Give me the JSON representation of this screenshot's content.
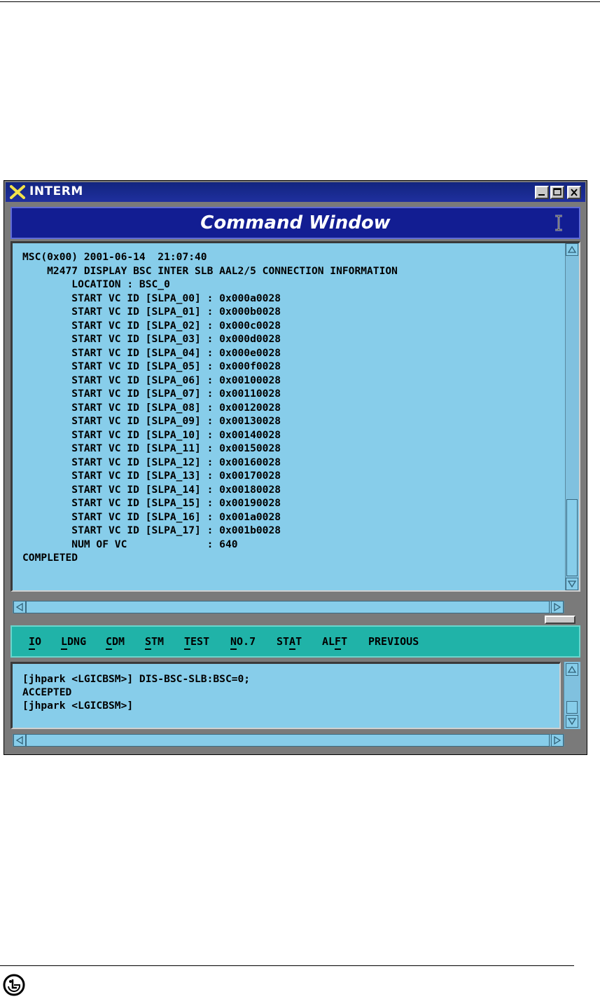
{
  "window": {
    "title": "INTERM",
    "command_title": "Command Window"
  },
  "output": {
    "lines": [
      "MSC(0x00) 2001-06-14  21:07:40",
      "    M2477 DISPLAY BSC INTER SLB AAL2/5 CONNECTION INFORMATION",
      "        LOCATION : BSC_0",
      "        START VC ID [SLPA_00] : 0x000a0028",
      "        START VC ID [SLPA_01] : 0x000b0028",
      "        START VC ID [SLPA_02] : 0x000c0028",
      "        START VC ID [SLPA_03] : 0x000d0028",
      "        START VC ID [SLPA_04] : 0x000e0028",
      "        START VC ID [SLPA_05] : 0x000f0028",
      "        START VC ID [SLPA_06] : 0x00100028",
      "        START VC ID [SLPA_07] : 0x00110028",
      "        START VC ID [SLPA_08] : 0x00120028",
      "        START VC ID [SLPA_09] : 0x00130028",
      "        START VC ID [SLPA_10] : 0x00140028",
      "        START VC ID [SLPA_11] : 0x00150028",
      "        START VC ID [SLPA_12] : 0x00160028",
      "        START VC ID [SLPA_13] : 0x00170028",
      "        START VC ID [SLPA_14] : 0x00180028",
      "        START VC ID [SLPA_15] : 0x00190028",
      "        START VC ID [SLPA_16] : 0x001a0028",
      "        START VC ID [SLPA_17] : 0x001b0028",
      "        NUM OF VC             : 640",
      "COMPLETED"
    ]
  },
  "menu": {
    "items": [
      "IO",
      "LDNG",
      "CDM",
      "STM",
      "TEST",
      "NO.7",
      "STAT",
      "ALFT",
      "PREVIOUS"
    ]
  },
  "input": {
    "lines": [
      "[jhpark <LGICBSM>] DIS-BSC-SLB:BSC=0;",
      "ACCEPTED",
      "[jhpark <LGICBSM>]"
    ]
  },
  "colors": {
    "title_bar": "#12257f",
    "command_bar": "#121d92",
    "output_bg": "#87cdea",
    "menu_bg": "#20b3a8"
  }
}
